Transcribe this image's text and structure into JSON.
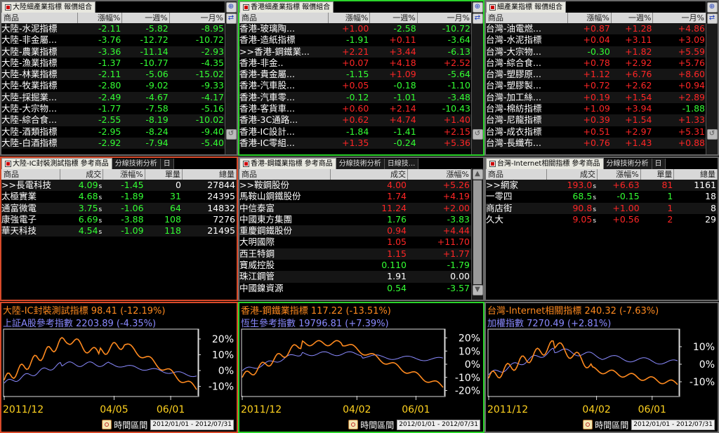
{
  "panels_top": [
    {
      "title": "大陸細產業指標 報價組合",
      "cols": [
        "商品",
        "漲幅%",
        "一週%",
        "一月%"
      ],
      "rows": [
        [
          "大陸-水泥指標",
          "-2.11",
          "-5.82",
          "-8.95"
        ],
        [
          "大陸-非金屬...",
          "-3.76",
          "-12.72",
          "-10.72"
        ],
        [
          "大陸-農業指標",
          "-3.36",
          "-11.14",
          "-2.93"
        ],
        [
          "大陸-漁業指標",
          "-1.37",
          "-10.77",
          "-4.35"
        ],
        [
          "大陸-林業指標",
          "-2.11",
          "-5.06",
          "-15.02"
        ],
        [
          "大陸-牧業指標",
          "-2.80",
          "-9.02",
          "-9.33"
        ],
        [
          "大陸-採掘業...",
          "-2.49",
          "-4.67",
          "-4.17"
        ],
        [
          "大陸-大宗物...",
          "-1.77",
          "-7.58",
          "-5.16"
        ],
        [
          "大陸-綜合食...",
          "-2.55",
          "-8.19",
          "-10.02"
        ],
        [
          "大陸-酒類指標",
          "-2.95",
          "-8.24",
          "-9.40"
        ],
        [
          "大陸-白酒指標",
          "-2.92",
          "-7.94",
          "-5.40"
        ]
      ]
    },
    {
      "title": "香港細產業指標 報價組合",
      "cols": [
        "商品",
        "漲幅%",
        "一週%",
        "一月%"
      ],
      "rows": [
        [
          "香港-玻璃陶...",
          "+1.00",
          "-2.58",
          "-10.72"
        ],
        [
          "香港-造紙指標",
          "-1.91",
          "+0.11",
          "-3.64"
        ],
        [
          ">>香港-鋼鐵業...",
          "+2.21",
          "+3.44",
          "-6.13"
        ],
        [
          "香港-非金..",
          "+0.07",
          "+4.18",
          "+2.52"
        ],
        [
          "香港-貴金屬...",
          "-1.15",
          "+1.09",
          "-5.64"
        ],
        [
          "香港-汽車股...",
          "+0.05",
          "-0.18",
          "-1.10"
        ],
        [
          "香港-汽車零...",
          "-0.12",
          "-1.01",
          "-3.48"
        ],
        [
          "香港-客貨車...",
          "+0.60",
          "+2.14",
          "-10.43"
        ],
        [
          "香港-3C通路...",
          "+0.62",
          "+4.74",
          "+1.40"
        ],
        [
          "香港-IC設計...",
          "-1.84",
          "-1.41",
          "+2.15"
        ],
        [
          "香港-IC零組...",
          "+1.35",
          "-0.24",
          "+5.36"
        ]
      ]
    },
    {
      "title": "細產業指標 報價組合",
      "cols": [
        "商品",
        "漲幅%",
        "一週%",
        "一月%"
      ],
      "rows": [
        [
          "台灣-油電燃...",
          "+0.87",
          "+1.28",
          "+4.86"
        ],
        [
          "台灣-水泥指標",
          "+0.04",
          "+3.11",
          "+3.09"
        ],
        [
          "台灣-大宗物...",
          "-0.30",
          "+1.82",
          "+5.59"
        ],
        [
          "台灣-綜合食...",
          "+0.78",
          "+2.92",
          "+5.76"
        ],
        [
          "台灣-塑膠原...",
          "+1.12",
          "+6.76",
          "+8.60"
        ],
        [
          "台灣-塑膠製...",
          "+0.72",
          "+2.62",
          "+0.94"
        ],
        [
          "台灣-加工絲...",
          "+0.19",
          "+1.54",
          "+2.89"
        ],
        [
          "台灣-棉紡指標",
          "+1.09",
          "+3.94",
          "-1.88"
        ],
        [
          "台灣-尼龍指標",
          "+0.39",
          "+1.54",
          "+1.33"
        ],
        [
          "台灣-成衣指標",
          "+0.51",
          "+2.97",
          "+5.31"
        ],
        [
          "台灣-長纖布...",
          "+0.76",
          "+1.43",
          "+0.88"
        ]
      ]
    }
  ],
  "panels_mid": [
    {
      "title": "大陸-IC封裝測試指標 參考商品",
      "tabs": [
        "分線技術分析",
        "日"
      ],
      "cols": [
        "商品",
        "成交",
        "漲幅%",
        "單量",
        "總量"
      ],
      "rows": [
        [
          ">>長電科技",
          "4.09",
          "-1.45",
          "0",
          "27844"
        ],
        [
          "太極實業",
          "4.68",
          "-1.89",
          "31",
          "24395"
        ],
        [
          "通富微電",
          "3.75",
          "-1.06",
          "64",
          "14832"
        ],
        [
          "康強電子",
          "6.69",
          "-3.88",
          "108",
          "7276"
        ],
        [
          "華天科技",
          "4.54",
          "-1.09",
          "118",
          "21495"
        ]
      ]
    },
    {
      "title": "香港-鋼鐵業指標 參考商品",
      "tabs": [
        "分線技術分析",
        "日線技..."
      ],
      "cols": [
        "商品",
        "成交",
        "漲幅%"
      ],
      "rows": [
        [
          ">>鞍鋼股份",
          "4.00",
          "+5.26"
        ],
        [
          "馬鞍山鋼鐵股份",
          "1.74",
          "+4.19"
        ],
        [
          "中信泰富",
          "11.24",
          "+2.00"
        ],
        [
          "中國東方集團",
          "1.76",
          "-3.83"
        ],
        [
          "重慶鋼鐵股份",
          "0.94",
          "+4.44"
        ],
        [
          "大明國際",
          "1.05",
          "+11.70"
        ],
        [
          "西王特鋼",
          "1.15",
          "+1.77"
        ],
        [
          "寶威控股",
          "0.110",
          "-1.79"
        ],
        [
          "珠江鋼管",
          "1.91",
          "0.00"
        ],
        [
          "中國鎳資源",
          "0.54",
          "-3.57"
        ]
      ]
    },
    {
      "title": "台灣-Internet相關指標 參考商品",
      "tabs": [
        "分線技術分析",
        "日"
      ],
      "cols": [
        "商品",
        "成交",
        "漲幅%",
        "單量",
        "總量"
      ],
      "rows": [
        [
          ">>網家",
          "193.0",
          "+6.63",
          "81",
          "1161"
        ],
        [
          "一零四",
          "68.5",
          "-0.15",
          "1",
          "18"
        ],
        [
          "商店街",
          "90.8",
          "+1.00",
          "1",
          "8"
        ],
        [
          "久大",
          "9.05",
          "+0.56",
          "2",
          "29"
        ]
      ]
    }
  ],
  "charts": [
    {
      "l1": "大陸-IC封裝測試指標 98.41 (-12.19%)",
      "l2": "上証A股參考指數 2203.89 (-4.35%)",
      "yticks": [
        "20%",
        "10%",
        "0%",
        "-10%"
      ],
      "xticks": [
        "2011/12",
        "04/05",
        "06/01"
      ]
    },
    {
      "l1": "香港-鋼鐵業指標 117.22 (-13.51%)",
      "l2": "恆生參考指數 19796.81 (+7.39%)",
      "yticks": [
        "20%",
        "10%",
        "0%",
        "-10%",
        "-20%"
      ],
      "xticks": [
        "2011/12",
        "04/02",
        "06/01"
      ]
    },
    {
      "l1": "台灣-Internet相關指標 240.32 (-7.63%)",
      "l2": "加權指數 7270.49 (+2.81%)",
      "yticks": [
        "10%",
        "0%",
        "-10%"
      ],
      "xticks": [
        "2011/12",
        "04/02",
        "06/01"
      ]
    }
  ],
  "footer": {
    "label": "時間區間",
    "range": "2012/01/01 - 2012/07/31"
  },
  "suffix": "s"
}
